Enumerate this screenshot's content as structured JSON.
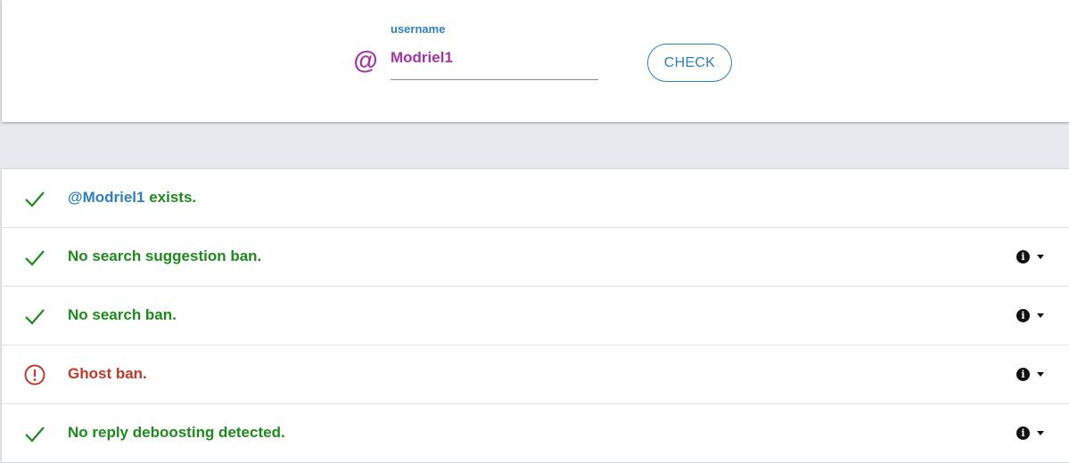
{
  "form": {
    "at_symbol": "@",
    "label": "username",
    "value": "Modriel1",
    "button_label": "CHECK"
  },
  "results": [
    {
      "status": "ok",
      "icon": "checkmark-icon",
      "mention": "@Modriel1",
      "text": " exists.",
      "has_info": false
    },
    {
      "status": "ok",
      "icon": "checkmark-icon",
      "text": "No search suggestion ban.",
      "has_info": true
    },
    {
      "status": "ok",
      "icon": "checkmark-icon",
      "text": "No search ban.",
      "has_info": true
    },
    {
      "status": "warning",
      "icon": "alert-circle-icon",
      "text": "Ghost ban.",
      "has_info": true
    },
    {
      "status": "ok",
      "icon": "checkmark-icon",
      "text": "No reply deboosting detected.",
      "has_info": true
    }
  ],
  "colors": {
    "ok": "#1e8a1e",
    "warning": "#c0392b",
    "accent": "#2e7fbf",
    "username": "#a633a8"
  }
}
